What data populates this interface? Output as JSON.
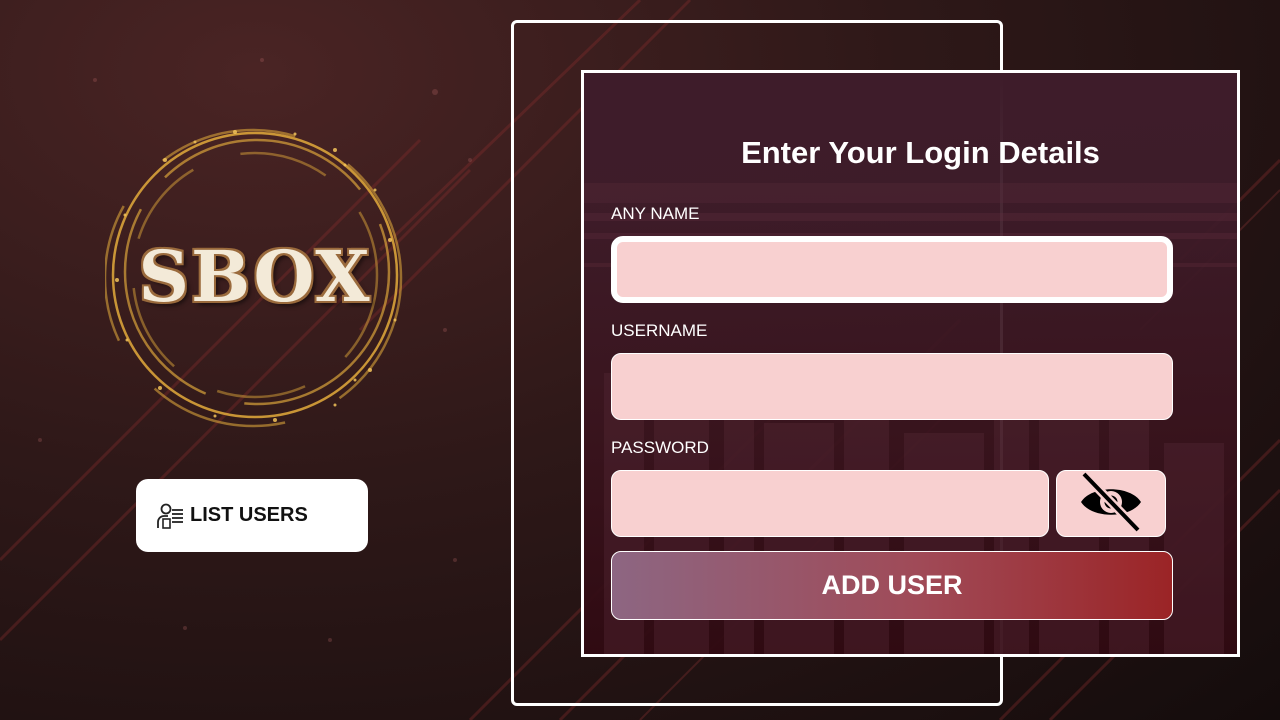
{
  "brand": {
    "logo_text": "SBOX"
  },
  "sidebar": {
    "list_users_label": "LIST USERS"
  },
  "form": {
    "title": "Enter Your Login Details",
    "any_name": {
      "label": "ANY NAME",
      "value": ""
    },
    "username": {
      "label": "USERNAME",
      "value": ""
    },
    "password": {
      "label": "PASSWORD",
      "value": ""
    },
    "toggle_password_icon": "eye-slash-icon",
    "submit_label": "ADD USER"
  },
  "colors": {
    "input_bg": "#f8d0d0",
    "button_gradient_start": "#8d6682",
    "button_gradient_end": "#9b2426",
    "logo_gold": "#d9a33a"
  }
}
